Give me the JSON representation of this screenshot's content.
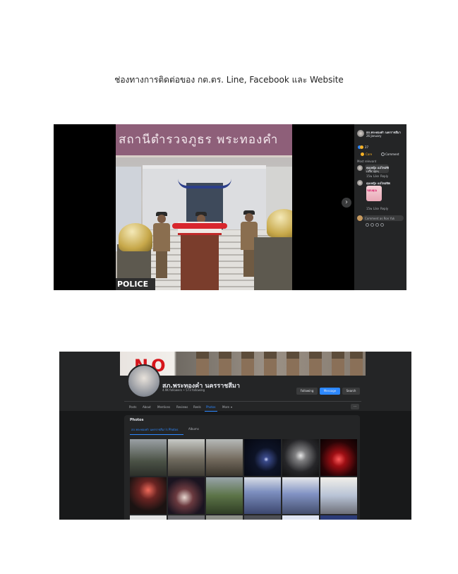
{
  "caption": "ช่องทางการติดต่อของ กต.ตร. Line, Facebook และ Website",
  "post_viewer": {
    "sign_text": "สถานีตำรวจภูธร พระทองคำ",
    "police_label": "POLICE",
    "next_icon": "chevron-right-icon",
    "page_name": "สภ.พระทองคำ นครราชสีมา",
    "post_date": "26 January",
    "reaction_count": "27",
    "care_label": "Care",
    "comment_label": "Comment",
    "sort_label": "Most relevant",
    "comment1_author": "คุณหญิง แม่ไหม่ทิพย์",
    "comment1_text": "เปรี้ยวสุดๆ",
    "comment1_time": "15w",
    "like_label": "Like",
    "reply_label": "Reply",
    "comment2_author": "คุณหญิง แม่ไหม่ทิพย์",
    "sticker_text": "ขอบคุณ",
    "comment2_time": "15w",
    "comment_placeholder": "Comment as Ron Yuk"
  },
  "fb_page": {
    "cover_text": "NO",
    "page_name": "สภ.พระทองคำ นครราชสีมา",
    "stats": "4.9K followers • 573 following",
    "following_label": "Following",
    "message_label": "Message",
    "search_label": "Search",
    "tabs": [
      "Posts",
      "About",
      "Mentions",
      "Reviews",
      "Reels",
      "Photos",
      "More"
    ],
    "active_tab": "Photos",
    "more_btn": "···",
    "photos_title": "Photos",
    "subtabs": [
      "สภ.พระทองคำ นครราชสีมา's Photos",
      "Albums"
    ]
  },
  "colors": {
    "fb_blue": "#2d88ff",
    "fb_dark": "#18191a",
    "fb_panel": "#242526"
  }
}
